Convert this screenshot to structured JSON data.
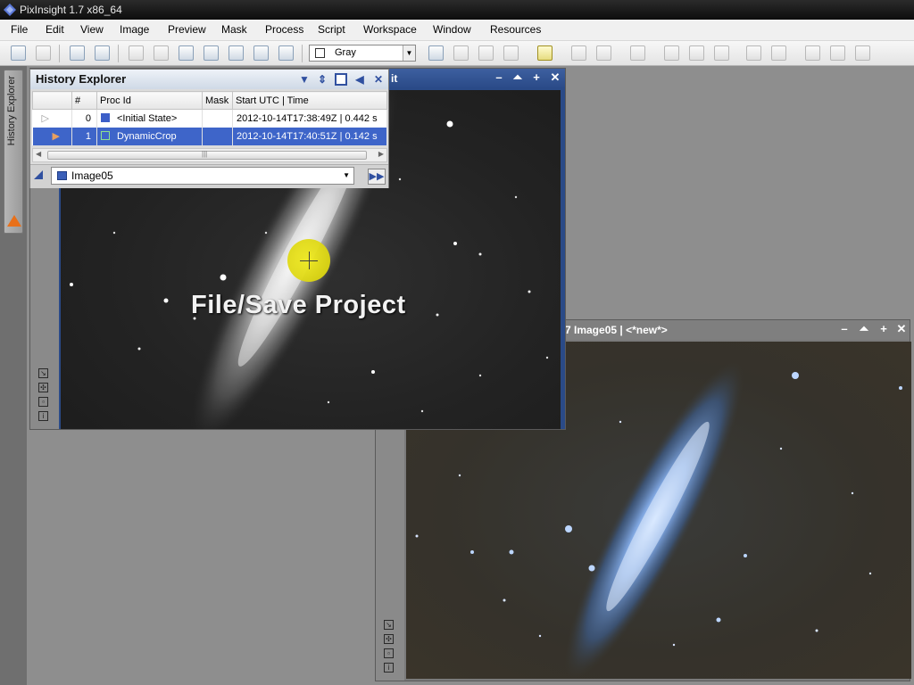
{
  "app": {
    "title": "PixInsight 1.7 x86_64"
  },
  "menu": [
    "File",
    "Edit",
    "View",
    "Image",
    "Preview",
    "Mask",
    "Process",
    "Script",
    "Workspace",
    "Window",
    "Resources"
  ],
  "toolbar": {
    "channel_combo": "Gray"
  },
  "sidebar": {
    "tab_label": "History Explorer"
  },
  "window1": {
    "title": "it"
  },
  "window2": {
    "title": "7 Image05 | <*new*>"
  },
  "history": {
    "title": "History Explorer",
    "columns": [
      "#",
      "Proc Id",
      "Mask",
      "Start UTC | Time"
    ],
    "rows": [
      {
        "num": "0",
        "proc": "<Initial State>",
        "mask": "",
        "time": "2012-10-14T17:38:49Z | 0.442 s"
      },
      {
        "num": "1",
        "proc": "DynamicCrop",
        "mask": "",
        "time": "2012-10-14T17:40:51Z | 0.142 s"
      }
    ],
    "scroll_grip": "|||",
    "image_selector": "Image05"
  },
  "overlay_text": "File/Save Project",
  "icons": {
    "app": "pixinsight-icon",
    "warning": "warning-icon",
    "cursor": "click-highlight"
  }
}
